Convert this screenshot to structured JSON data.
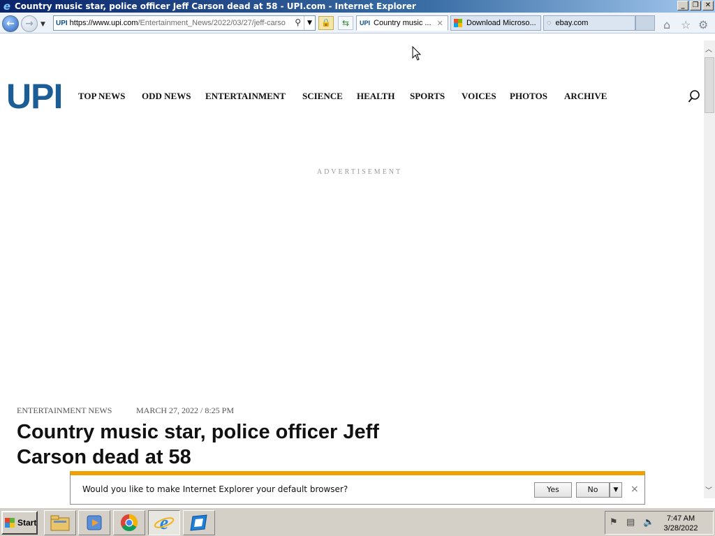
{
  "window": {
    "title": "Country music star, police officer Jeff Carson dead at 58 - UPI.com - Internet Explorer",
    "icon": "ie-icon",
    "controls": {
      "minimize": "_",
      "maximize": "❐",
      "close": "✕"
    }
  },
  "navigation": {
    "address_prefix": "https://www.",
    "address_domain": "upi.com",
    "address_path": "/Entertainment_News/2022/03/27/jeff-carso",
    "favicon_text": "UPI",
    "tabs": [
      {
        "label": "Country music ...",
        "favicon": "UPI",
        "active": true,
        "close": "✕"
      },
      {
        "label": "Download Microso...",
        "favicon": "microsoft-logo",
        "active": false
      },
      {
        "label": "ebay.com",
        "favicon": "loading-spinner",
        "active": false
      }
    ]
  },
  "site": {
    "logo": "UPI",
    "nav": [
      "TOP NEWS",
      "ODD NEWS",
      "ENTERTAINMENT",
      "SCIENCE",
      "HEALTH",
      "SPORTS",
      "VOICES",
      "PHOTOS",
      "ARCHIVE"
    ]
  },
  "advertisement_label": "ADVERTISEMENT",
  "article": {
    "category": "ENTERTAINMENT NEWS",
    "date": "MARCH 27, 2022 / 8:25 PM",
    "headline": "Country music star, police officer Jeff Carson dead at 58"
  },
  "notification": {
    "message": "Would you like to make Internet Explorer your default browser?",
    "yes_label": "Yes",
    "no_label": "No",
    "close": "×"
  },
  "taskbar": {
    "start_label": "Start",
    "apps": [
      "file-explorer",
      "media-player",
      "chrome",
      "internet-explorer",
      "remote-desktop"
    ],
    "clock_time": "7:47 AM",
    "clock_date": "3/28/2022"
  },
  "colors": {
    "upi_blue": "#1c5d96",
    "notify_bar": "#f0a000",
    "titlebar": "#0a246a"
  }
}
